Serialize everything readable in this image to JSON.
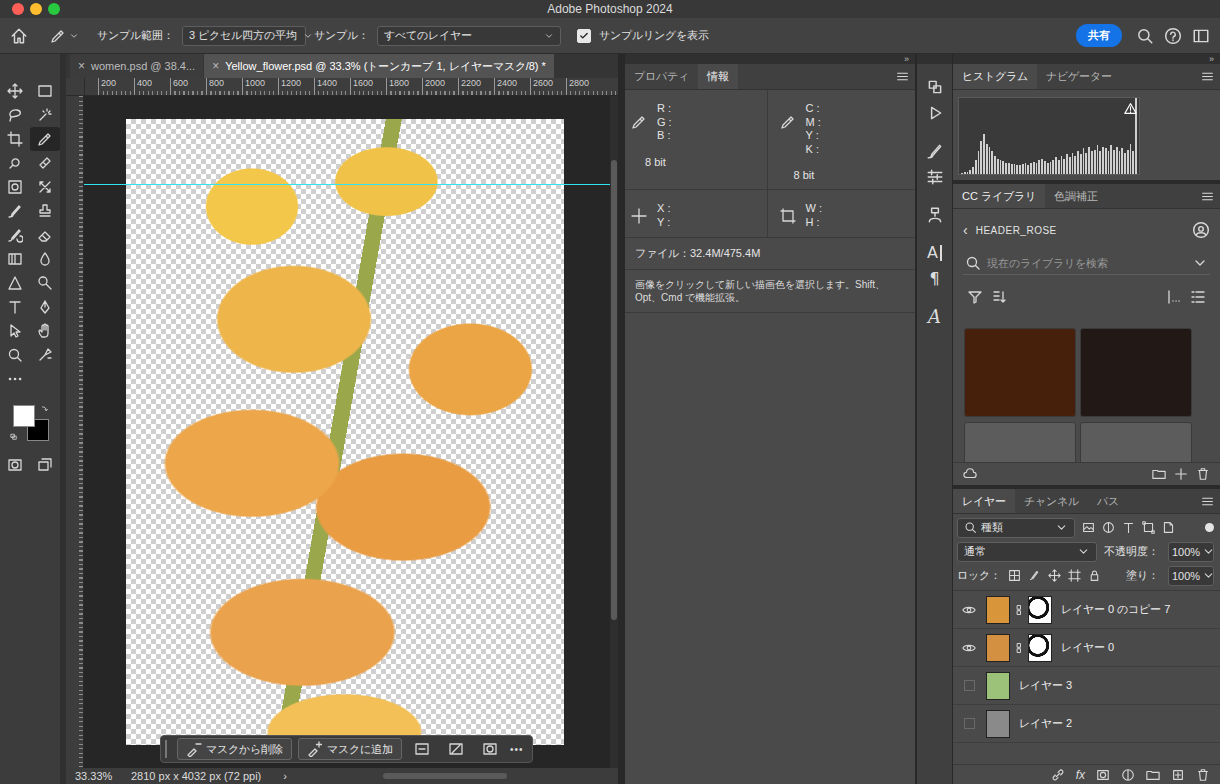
{
  "window": {
    "title": "Adobe Photoshop 2024"
  },
  "options_bar": {
    "sample_size_label": "サンプル範囲：",
    "sample_size": "3 ピクセル四方の平均",
    "sample_label": "サンプル：",
    "sample": "すべてのレイヤー",
    "show_ring": {
      "label": "サンプルリングを表示",
      "checked": true
    },
    "share": "共有"
  },
  "tools": [
    {
      "kind": "move",
      "selected": false
    },
    {
      "kind": "marquee",
      "selected": false
    },
    {
      "kind": "lasso",
      "selected": false
    },
    {
      "kind": "quick",
      "selected": false
    },
    {
      "kind": "crop",
      "selected": false
    },
    {
      "kind": "eyedropper",
      "selected": true
    },
    {
      "kind": "healing",
      "selected": false
    },
    {
      "kind": "bandage",
      "selected": false
    },
    {
      "kind": "frame",
      "selected": false
    },
    {
      "kind": "cross",
      "selected": false
    },
    {
      "kind": "brush",
      "selected": false
    },
    {
      "kind": "stamp",
      "selected": false
    },
    {
      "kind": "historybrush",
      "selected": false
    },
    {
      "kind": "eraser",
      "selected": false
    },
    {
      "kind": "gradient",
      "selected": false
    },
    {
      "kind": "blur",
      "selected": false
    },
    {
      "kind": "sharpen",
      "selected": false
    },
    {
      "kind": "dodge",
      "selected": false
    },
    {
      "kind": "type",
      "selected": false
    },
    {
      "kind": "pen",
      "selected": false
    },
    {
      "kind": "pathselect",
      "selected": false
    },
    {
      "kind": "hand",
      "selected": false
    },
    {
      "kind": "zoom",
      "selected": false
    },
    {
      "kind": "spot",
      "selected": false
    },
    {
      "kind": "more",
      "selected": false
    }
  ],
  "colors": {
    "foreground": "#ffffff",
    "background": "#000000"
  },
  "document_tabs": [
    {
      "label": "women.psd @ 38.4...",
      "close": "×",
      "selected": false
    },
    {
      "label": "Yellow_flower.psd @ 33.3% (トーンカーブ 1, レイヤーマスク/8) *",
      "close": "×",
      "selected": true
    }
  ],
  "ruler": {
    "ticks": [
      "200",
      "400",
      "600",
      "800",
      "1000",
      "1200",
      "1400",
      "1600",
      "1800",
      "2000",
      "2200",
      "2400",
      "2600",
      "2800"
    ]
  },
  "canvas": {
    "zoom": "33.33%",
    "doc_info": "2810 px x 4032 px (72 ppi)",
    "status_arrow": "›"
  },
  "task_bar": {
    "buttons": [
      "マスクから削除",
      "マスクに追加"
    ],
    "more": "•••"
  },
  "collapse_marks": {
    "info": "»",
    "right": "»"
  },
  "info_panel": {
    "tabs": [
      {
        "label": "プロパティ",
        "selected": false
      },
      {
        "label": "情報",
        "selected": true
      }
    ],
    "rgb": {
      "labels": [
        "R :",
        "G :",
        "B :"
      ],
      "depth": "8 bit"
    },
    "cmyk": {
      "labels": [
        "C :",
        "M :",
        "Y :",
        "K :"
      ],
      "depth": "8 bit"
    },
    "xy": [
      "X :",
      "Y :"
    ],
    "wh": [
      "W :",
      "H :"
    ],
    "file": "ファイル：32.4M/475.4M",
    "hint": "画像をクリックして新しい描画色を選択します。Shift、Opt、Cmd で機能拡張。"
  },
  "side_strip": [
    {
      "kind": "history",
      "glyph": ""
    },
    {
      "kind": "play",
      "glyph": ""
    },
    {
      "kind": "brushpreset",
      "glyph": ""
    },
    {
      "kind": "sliders",
      "glyph": ""
    },
    {
      "kind": "clonesrc",
      "glyph": ""
    },
    {
      "kind": "character",
      "glyph": "A"
    },
    {
      "kind": "paragraph",
      "glyph": "¶"
    },
    {
      "kind": "glyphs",
      "glyph": "A"
    }
  ],
  "histogram": {
    "tabs": [
      {
        "label": "ヒストグラム",
        "selected": true
      },
      {
        "label": "ナビゲーター",
        "selected": false
      }
    ],
    "values": [
      1,
      2,
      3,
      5,
      9,
      18,
      30,
      44,
      52,
      40,
      36,
      30,
      24,
      20,
      18,
      17,
      15,
      14,
      13,
      13,
      12,
      12,
      13,
      14,
      12,
      15,
      16,
      14,
      18,
      20,
      17,
      15,
      16,
      18,
      22,
      19,
      24,
      20,
      26,
      22,
      28,
      24,
      30,
      26,
      34,
      28,
      36,
      30,
      32,
      38,
      30,
      36,
      34,
      30,
      38,
      32,
      36,
      30,
      34,
      28,
      32,
      40,
      30,
      100
    ]
  },
  "library": {
    "tabs": [
      {
        "label": "CC ライブラリ",
        "selected": true
      },
      {
        "label": "色調補正",
        "selected": false
      }
    ],
    "back": "‹",
    "name": "HEADER_ROSE",
    "search_placeholder": "現在のライブラリを検索",
    "swatches": [
      {
        "color": "#46200b"
      },
      {
        "color": "#221815"
      },
      {
        "color": "#5c5c5c"
      },
      {
        "color": "#5c5c5c"
      }
    ]
  },
  "layers": {
    "tabs": [
      {
        "label": "レイヤー",
        "selected": true
      },
      {
        "label": "チャンネル",
        "selected": false
      },
      {
        "label": "パス",
        "selected": false
      }
    ],
    "filter": "種類",
    "blend": "通常",
    "opacity_label": "不透明度：",
    "opacity": "100%",
    "lock_label": "ロック：",
    "fill_label": "塗り：",
    "fill": "100%",
    "items": [
      {
        "name": "レイヤー 0 のコピー 7",
        "visible": true,
        "mask": true,
        "color": "#d8953a"
      },
      {
        "name": "レイヤー 0",
        "visible": true,
        "mask": true,
        "color": "#d29040"
      },
      {
        "name": "レイヤー 3",
        "visible": false,
        "mask": false,
        "color": "#9cc27a"
      },
      {
        "name": "レイヤー 2",
        "visible": false,
        "mask": false,
        "color": "#8a8a8a"
      }
    ],
    "fx": "fx"
  }
}
